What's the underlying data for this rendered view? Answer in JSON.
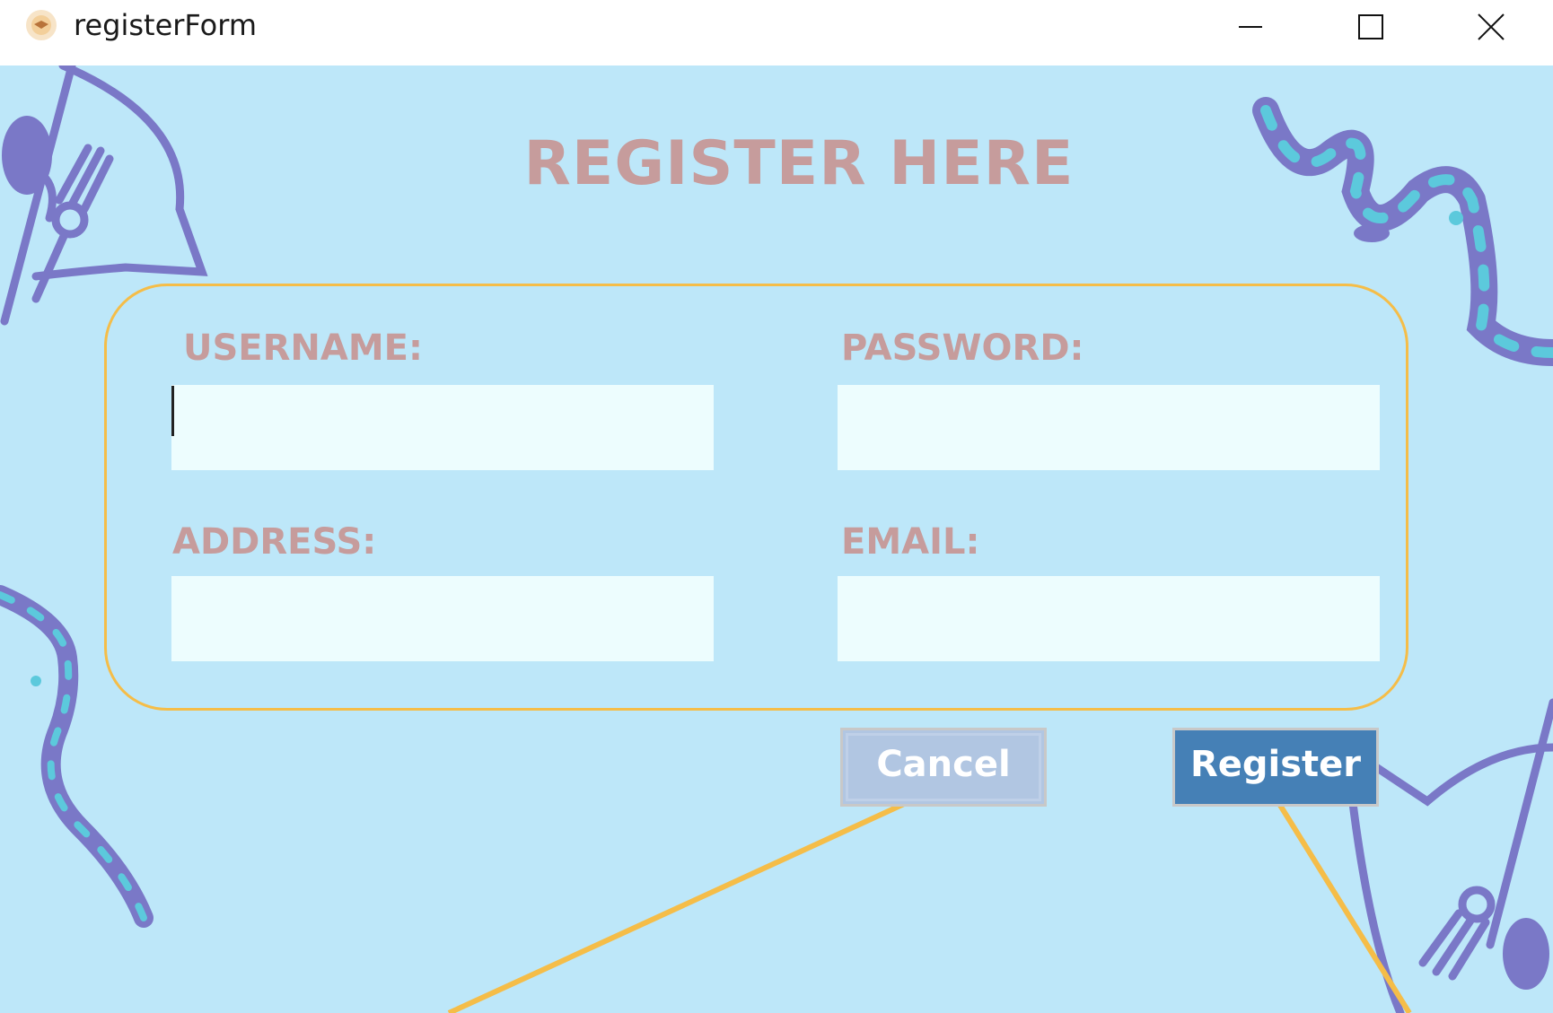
{
  "window": {
    "title": "registerForm",
    "icon": "app-logo-icon",
    "controls": [
      "minimize-icon",
      "maximize-icon",
      "close-icon"
    ]
  },
  "form": {
    "heading": "REGISTER HERE",
    "fields": {
      "username": {
        "label": "USERNAME:",
        "value": ""
      },
      "password": {
        "label": "PASSWORD:",
        "value": ""
      },
      "address": {
        "label": "ADDRESS:",
        "value": ""
      },
      "email": {
        "label": "EMAIL:",
        "value": ""
      }
    },
    "buttons": {
      "cancel": "Cancel",
      "register": "Register"
    }
  },
  "colors": {
    "background": "#bde7f9",
    "heading": "#c69c9c",
    "panel_border": "#f5bd48",
    "field_bg": "#edfdfe",
    "cancel_bg": "#b1c6e2",
    "register_bg": "#4580b6",
    "decor_purple": "#7a78c7",
    "decor_cyan": "#5cc9dc"
  }
}
